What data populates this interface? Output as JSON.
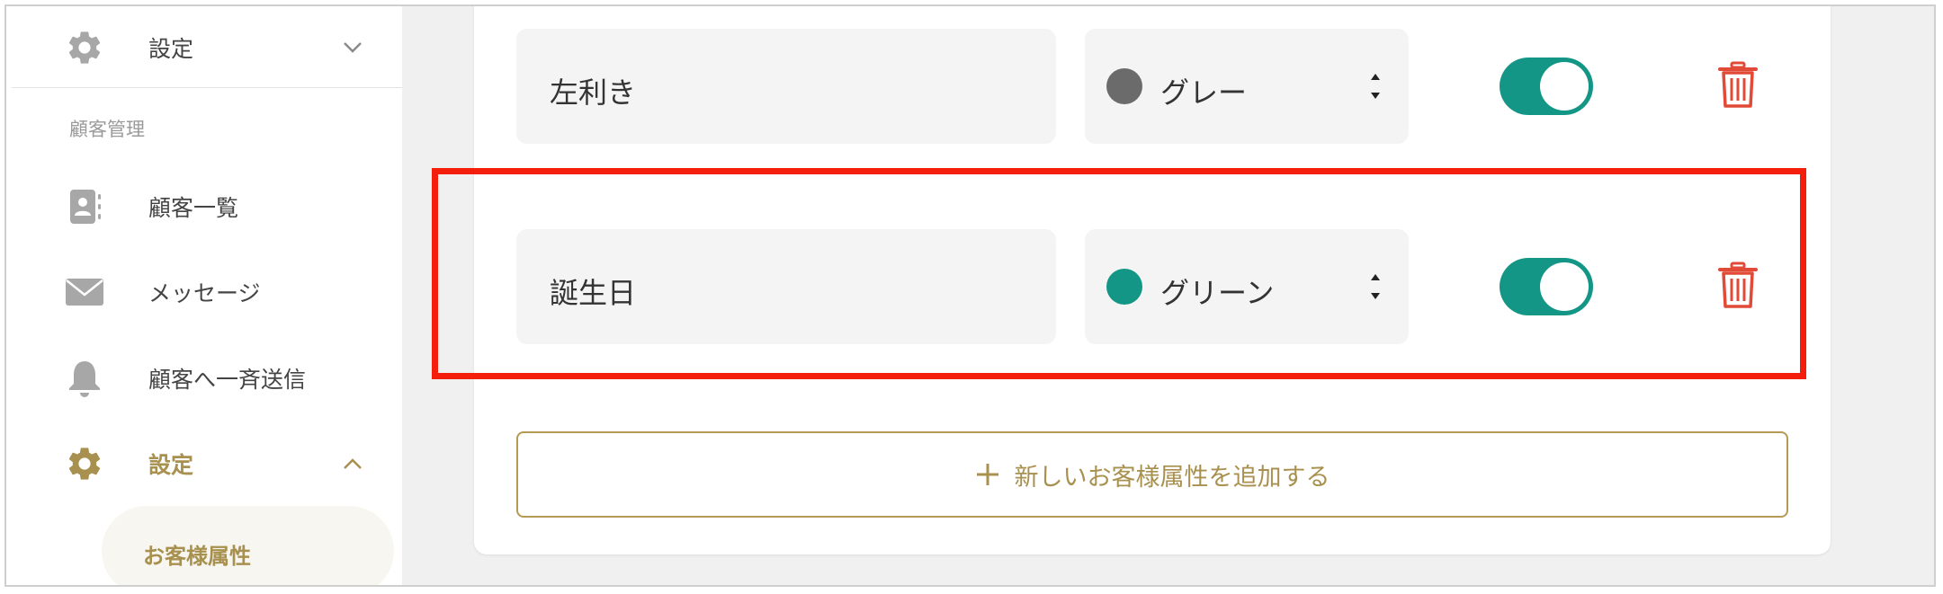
{
  "sidebar": {
    "top_item": {
      "label": "設定",
      "icon": "gear-icon"
    },
    "section_title": "顧客管理",
    "items": [
      {
        "label": "顧客一覧",
        "icon": "contact-card-icon"
      },
      {
        "label": "メッセージ",
        "icon": "envelope-icon"
      },
      {
        "label": "顧客へ一斉送信",
        "icon": "bell-icon"
      },
      {
        "label": "設定",
        "icon": "gear-icon"
      }
    ],
    "active_sub_item": "お客様属性"
  },
  "attributes": [
    {
      "name": "左利き",
      "color_label": "グレー",
      "color": "#6b6b6b",
      "enabled": true
    },
    {
      "name": "誕生日",
      "color_label": "グリーン",
      "color": "#139686",
      "enabled": true
    }
  ],
  "add_button_label": "新しいお客様属性を追加する",
  "colors": {
    "accent_gold": "#a8904f",
    "toggle_on": "#139686",
    "delete_red": "#e04a36",
    "highlight": "#f41e0c"
  }
}
